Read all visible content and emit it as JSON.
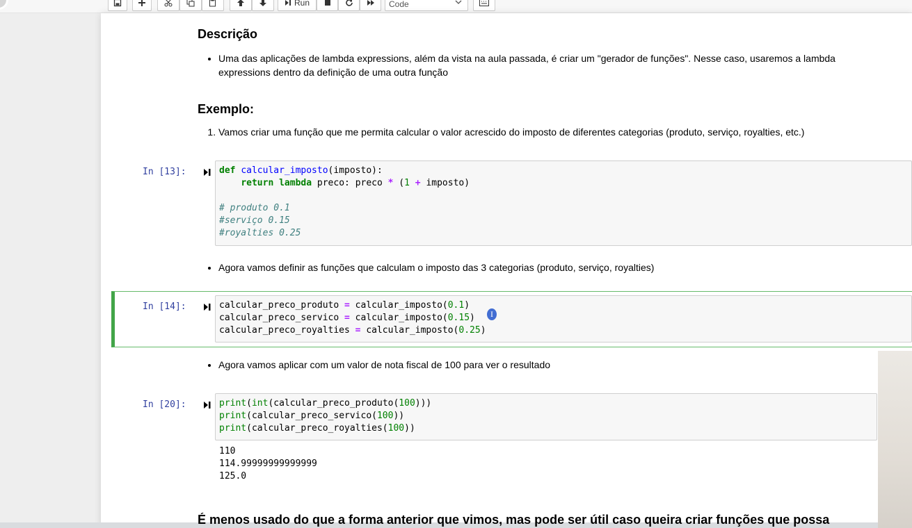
{
  "toolbar": {
    "run_label": "Run",
    "cell_type": "Code",
    "icons": [
      "save-icon",
      "plus-icon",
      "cut-icon",
      "copy-icon",
      "paste-icon",
      "arrow-up-icon",
      "arrow-down-icon",
      "run-icon",
      "stop-icon",
      "restart-icon",
      "fast-forward-icon",
      "chevron-down-icon",
      "keyboard-icon"
    ]
  },
  "markdown": {
    "descricao_title": "Descrição",
    "descricao_bullet_line1": "Uma das aplicações de lambda expressions, além da vista na aula passada, é criar um \"gerador de funções\". Nesse caso, usaremos a lambda",
    "descricao_bullet_line2": "expressions dentro da definição de uma outra função",
    "exemplo_title": "Exemplo:",
    "exemplo_item1": "Vamos criar uma função que me permita calcular o valor acrescido do imposto de diferentes categorias (produto, serviço, royalties, etc.)",
    "bullet_definir": "Agora vamos definir as funções que calculam o imposto das 3 categorias (produto, serviço, royalties)",
    "bullet_aplicar": "Agora vamos aplicar com um valor de nota fiscal de 100 para ver o resultado",
    "bottom_heading": "É menos usado do que a forma anterior que vimos, mas pode ser útil caso queira criar funções que possa"
  },
  "cells": [
    {
      "prompt": "In [13]:",
      "lines": [
        {
          "t1": "def",
          "t2": " ",
          "t3": "calcular_imposto",
          "t4": "(imposto):"
        },
        {
          "t1": "    ",
          "t2": "return",
          "t3": " ",
          "t4": "lambda",
          "t5": " preco: preco ",
          "t6": "*",
          "t7": " (",
          "t8": "1",
          "t9": " ",
          "t10": "+",
          "t11": " imposto)"
        },
        {
          "c": "# produto 0.1"
        },
        {
          "c": "#serviço 0.15"
        },
        {
          "c": "#royalties 0.25"
        }
      ]
    },
    {
      "prompt": "In [14]:",
      "lines": [
        {
          "a": "calcular_preco_produto ",
          "op": "=",
          "b": " calcular_imposto(",
          "n": "0.1",
          "e": ")"
        },
        {
          "a": "calcular_preco_servico ",
          "op": "=",
          "b": " calcular_imposto(",
          "n": "0.15",
          "e": ")"
        },
        {
          "a": "calcular_preco_royalties ",
          "op": "=",
          "b": " calcular_imposto(",
          "n": "0.25",
          "e": ")"
        }
      ]
    },
    {
      "prompt": "In [20]:",
      "lines": [
        {
          "p": "print",
          "a": "(",
          "i": "int",
          "b": "(calcular_preco_produto(",
          "n": "100",
          "e": ")))"
        },
        {
          "p": "print",
          "a": "(calcular_preco_servico(",
          "n": "100",
          "e": "))"
        },
        {
          "p": "print",
          "a": "(calcular_preco_royalties(",
          "n": "100",
          "e": "))"
        }
      ],
      "outputs": [
        "110",
        "114.99999999999999",
        "125.0"
      ]
    }
  ],
  "cursor_glyph": "I"
}
